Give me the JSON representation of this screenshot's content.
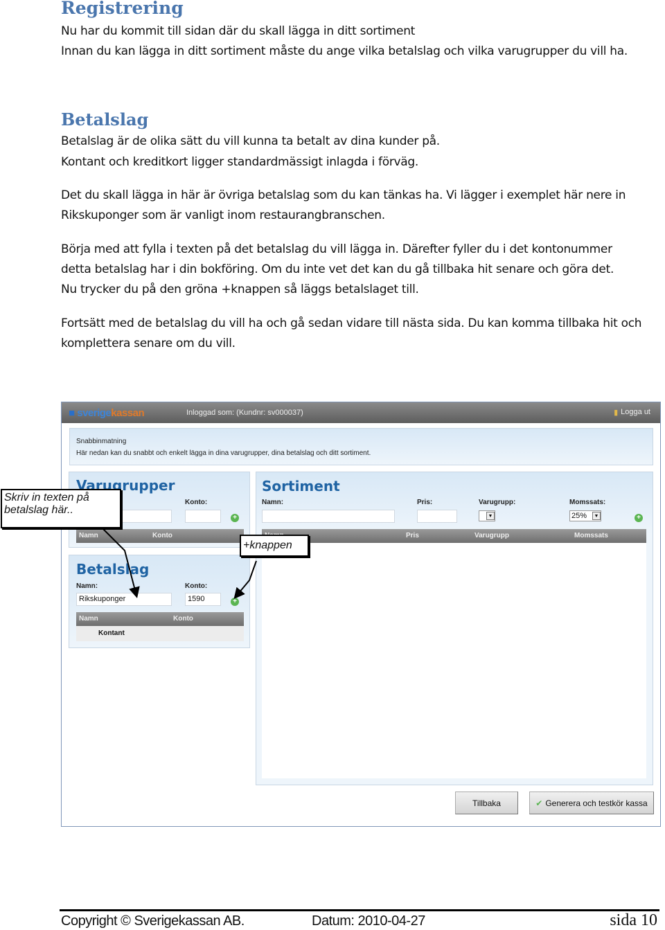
{
  "doc": {
    "title": "Registrering",
    "intro": [
      "Nu har du kommit till sidan där du skall lägga in ditt sortiment",
      "Innan du kan lägga in ditt sortiment måste du ange vilka betalslag och vilka varugrupper du vill ha."
    ],
    "section_title": "Betalslag",
    "paragraphs": [
      [
        "Betalslag är de olika sätt du vill kunna ta betalt av dina kunder på.",
        "Kontant och kreditkort ligger standardmässigt inlagda i förväg."
      ],
      [
        "Det du skall lägga in här är övriga betalslag som du kan tänkas ha. Vi lägger i exemplet här nere in",
        "Rikskuponger som är vanligt inom restaurangbranschen."
      ],
      [
        "Börja med att fylla i texten på det betalslag du vill lägga in. Därefter fyller du i det kontonummer",
        "detta betalslag har i din bokföring. Om du inte vet det kan du gå tillbaka hit senare och göra det.",
        "Nu trycker du på den gröna +knappen så läggs betalslaget till."
      ],
      [
        "Fortsätt med de betalslag du vill ha och gå sedan vidare till nästa sida. Du kan komma tillbaka hit och",
        "komplettera senare om du vill."
      ]
    ]
  },
  "app": {
    "logo_a": "sverige",
    "logo_b": "kassan",
    "logged_in": "Inloggad som: (Kundnr: sv000037)",
    "logout": "Logga ut",
    "quick": {
      "title": "Snabbinmatning",
      "text": "Här nedan kan du snabbt och enkelt lägga in dina varugrupper, dina betalslag och ditt sortiment."
    },
    "varugrupper": {
      "title": "Varugrupper",
      "konto_label": "Konto:",
      "name_value": "",
      "konto_value": "",
      "cols": [
        "Namn",
        "Konto"
      ]
    },
    "betalslag": {
      "title": "Betalslag",
      "name_label": "Namn:",
      "konto_label": "Konto:",
      "name_value": "Rikskuponger",
      "konto_value": "1590",
      "cols": [
        "Namn",
        "Konto"
      ],
      "rows": [
        "Kontant"
      ]
    },
    "sortiment": {
      "title": "Sortiment",
      "labels": {
        "namn": "Namn:",
        "pris": "Pris:",
        "varugrupp": "Varugrupp:",
        "momssats": "Momssats:"
      },
      "momssats_value": "25%",
      "cols": [
        "Namn",
        "Pris",
        "Varugrupp",
        "Momssats"
      ]
    },
    "buttons": {
      "back": "Tillbaka",
      "generate": "Generera och testkör kassa"
    }
  },
  "callouts": {
    "text_hint": "Skriv in texten på betalslag här..",
    "plus_hint": "+knappen"
  },
  "footer": {
    "copyright": "Copyright ©  Sverigekassan AB.",
    "date": "Datum:  2010-04-27",
    "page": "sida 10"
  },
  "colors": {
    "heading": "#4a76ad",
    "panel_title": "#1f63a3",
    "plus": "#5bb552"
  }
}
